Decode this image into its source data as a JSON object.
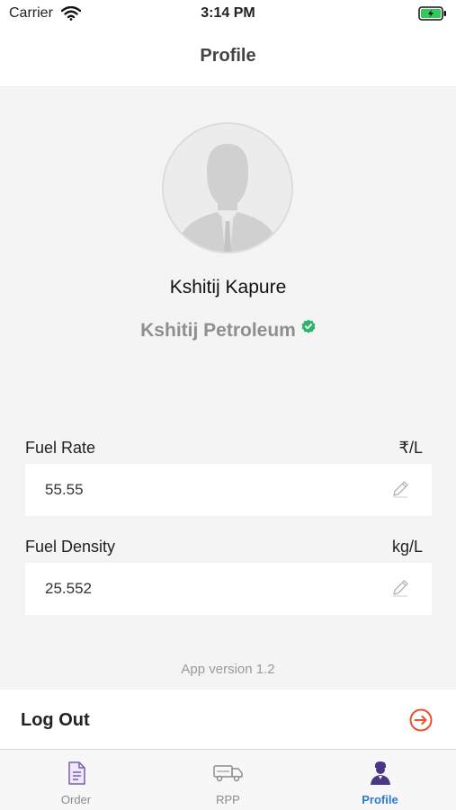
{
  "status_bar": {
    "carrier": "Carrier",
    "time": "3:14 PM"
  },
  "nav": {
    "title": "Profile"
  },
  "profile": {
    "name": "Kshitij Kapure",
    "company": "Kshitij Petroleum",
    "verified": true
  },
  "fields": {
    "fuel_rate": {
      "label": "Fuel Rate",
      "unit": "₹/L",
      "value": "55.55"
    },
    "fuel_density": {
      "label": "Fuel Density",
      "unit": "kg/L",
      "value": "25.552"
    }
  },
  "app_version": "App version 1.2",
  "logout": {
    "label": "Log Out"
  },
  "tabs": [
    {
      "label": "Order",
      "icon": "document-icon",
      "active": false
    },
    {
      "label": "RPP",
      "icon": "truck-icon",
      "active": false
    },
    {
      "label": "Profile",
      "icon": "user-icon",
      "active": true
    }
  ],
  "colors": {
    "accent": "#2a7bd6",
    "logout": "#e8512d",
    "verified": "#2fb36b",
    "battery": "#34c759"
  }
}
